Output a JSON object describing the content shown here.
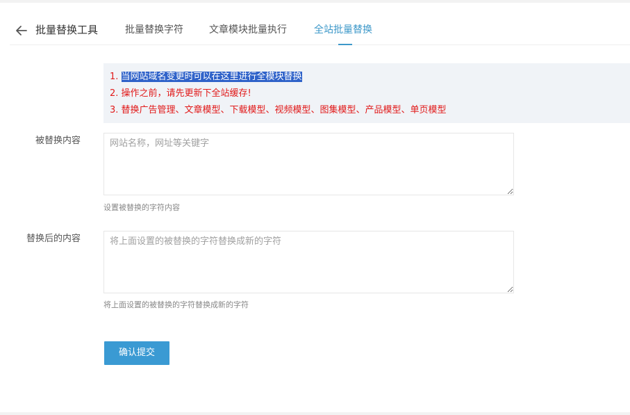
{
  "header": {
    "back_icon": "arrow-left-icon",
    "title": "批量替换工具",
    "tabs": [
      {
        "label": "批量替换字符",
        "active": false
      },
      {
        "label": "文章模块批量执行",
        "active": false
      },
      {
        "label": "全站批量替换",
        "active": true
      }
    ]
  },
  "notice": {
    "line1_prefix": "1. ",
    "line1_highlight": "当网站域名变更时可以在这里进行全模块替换",
    "line2": "2. 操作之前，请先更新下全站缓存!",
    "line3": "3. 替换广告管理、文章模型、下载模型、视频模型、图集模型、产品模型、单页模型"
  },
  "form": {
    "source": {
      "label": "被替换内容",
      "value": "",
      "placeholder": "网站名称，网址等关键字",
      "hint": "设置被替换的字符内容"
    },
    "target": {
      "label": "替换后的内容",
      "value": "",
      "placeholder": "将上面设置的被替换的字符替换成新的字符",
      "hint": "将上面设置的被替换的字符替换成新的字符"
    },
    "submit_label": "确认提交"
  },
  "colors": {
    "accent": "#3d98c9",
    "button": "#3a9ad3",
    "notice_text": "#e11919",
    "highlight": "#2f62c9"
  }
}
